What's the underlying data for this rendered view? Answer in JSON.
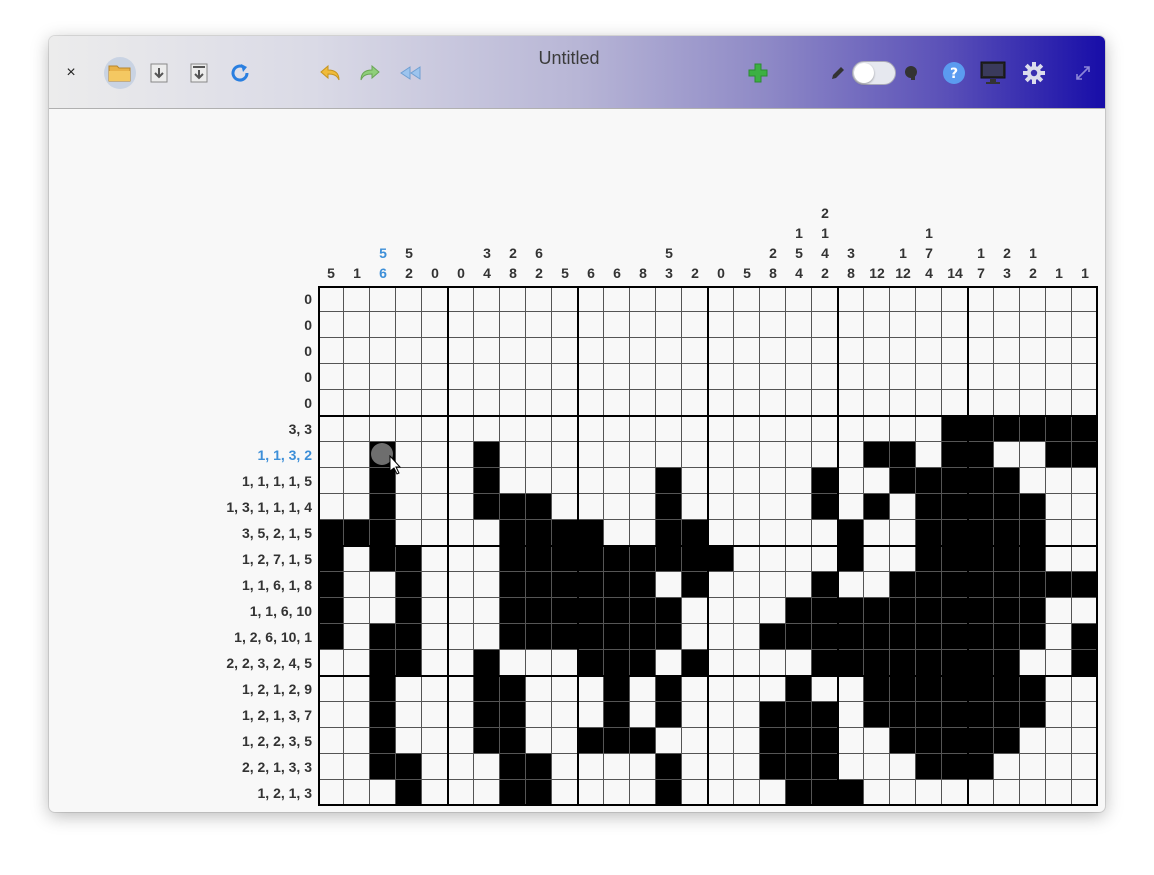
{
  "window": {
    "title": "Untitled"
  },
  "toolbar": {
    "close_label": "×",
    "icons": [
      "close-icon",
      "open-folder-icon",
      "save-icon",
      "save-as-icon",
      "refresh-icon",
      "undo-icon",
      "redo-icon",
      "rewind-icon",
      "add-icon",
      "pencil-icon",
      "toggle-switch",
      "brain-icon",
      "help-icon",
      "monitor-icon",
      "gear-icon",
      "fullscreen-icon"
    ],
    "toggle_on": false
  },
  "puzzle": {
    "columns": 30,
    "rows": 20,
    "active_row": 6,
    "active_column": 2,
    "column_clues": [
      [
        "5"
      ],
      [
        "1"
      ],
      [
        "5",
        "6"
      ],
      [
        "5",
        "2"
      ],
      [
        "0"
      ],
      [
        "0"
      ],
      [
        "3",
        "4"
      ],
      [
        "2",
        "8"
      ],
      [
        "6",
        "2"
      ],
      [
        "5"
      ],
      [
        "6"
      ],
      [
        "6"
      ],
      [
        "8"
      ],
      [
        "5",
        "3"
      ],
      [
        "2"
      ],
      [
        "0"
      ],
      [
        "5"
      ],
      [
        "2",
        "8"
      ],
      [
        "1",
        "5",
        "4"
      ],
      [
        "2",
        "1",
        "4",
        "2"
      ],
      [
        "3",
        "8"
      ],
      [
        "12"
      ],
      [
        "1",
        "12"
      ],
      [
        "1",
        "7",
        "4"
      ],
      [
        "14"
      ],
      [
        "1",
        "7"
      ],
      [
        "2",
        "3"
      ],
      [
        "1",
        "2"
      ],
      [
        "1"
      ],
      [
        "1"
      ]
    ],
    "row_clues": [
      "0",
      "0",
      "0",
      "0",
      "0",
      "3, 3",
      "1, 1, 3, 2",
      "1, 1, 1, 1, 5",
      "1, 3, 1, 1, 1, 4",
      "3, 5, 2, 1, 5",
      "1, 2, 7, 1, 5",
      "1, 1, 6, 1, 8",
      "1, 1, 6, 10",
      "1, 2, 6, 10, 1",
      "2, 2, 3, 2, 4, 5",
      "1, 2, 1, 2, 9",
      "1, 2, 1, 3, 7",
      "1, 2, 2, 3, 5",
      "2, 2, 1, 3, 3",
      "1, 2, 1, 3"
    ],
    "grid": [
      "..............................",
      "..............................",
      "..............................",
      "..............................",
      "..............................",
      "........................######",
      "..#...#..............##.##..##",
      "..#...#......#.....#..#####...",
      "..#...###....#.....#.#.#####..",
      "###....####..##.....#..#####..",
      "#.##...#########....#..#####..",
      "#..#...######.#....#..########",
      "#..#...#######....##########..",
      "#.##...#######...###########.#",
      "..##..#...###.#....########..#",
      "..#...##...#.#....#..#######..",
      "..#...##...#.#...###.#######..",
      "..#...##..###....###..#####...",
      "..##...##....#...###...###....",
      "...#...##....#....###.........."
    ]
  }
}
